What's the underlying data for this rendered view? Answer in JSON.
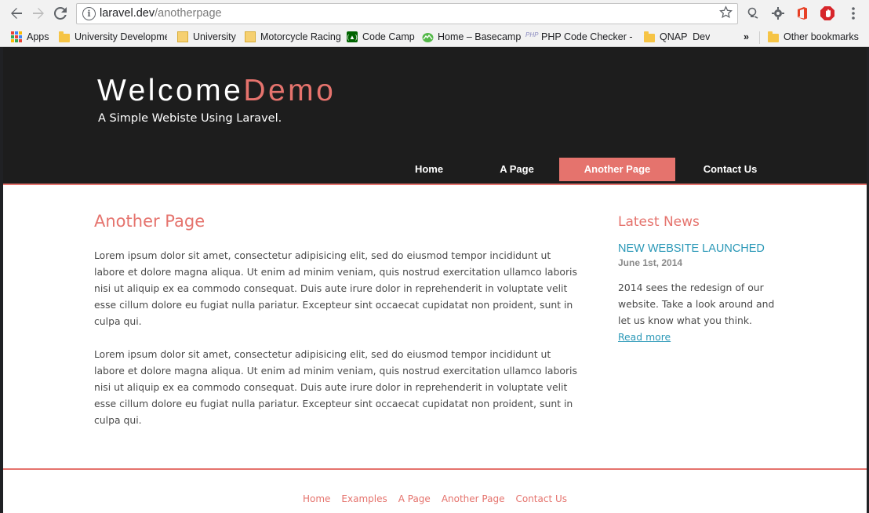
{
  "browser": {
    "url_host": "laravel.dev",
    "url_path": "/anotherpage",
    "buttons": {
      "back": "back-arrow-icon",
      "forward": "forward-arrow-icon",
      "reload": "reload-icon",
      "site_info": "info-icon",
      "bookmark": "star-icon",
      "menu": "kebab-menu-icon"
    },
    "site_info_glyph": "i",
    "bookmarks": [
      {
        "label": "Apps",
        "icon": "apps-grid-icon"
      },
      {
        "label": "University Developme",
        "icon": "folder-icon"
      },
      {
        "label": "University",
        "icon": "page-icon"
      },
      {
        "label": "Motorcycle Racing",
        "icon": "page-icon"
      },
      {
        "label": "Code Camp",
        "icon": "codecamp-icon"
      },
      {
        "label": "Home – Basecamp",
        "icon": "basecamp-icon"
      },
      {
        "label": "PHP Code Checker - S",
        "icon": "php-icon"
      },
      {
        "label": "QNAP  Dev",
        "icon": "folder-icon"
      }
    ],
    "overflow_label": "»",
    "other_bookmarks": "Other bookmarks"
  },
  "site": {
    "logo_main": "Welcome",
    "logo_accent": "Demo",
    "tagline": "A Simple Webiste Using Laravel.",
    "accent_color": "#e5736d",
    "link_color": "#2a98b7",
    "header_bg": "#1d1d1d",
    "menu": [
      {
        "label": "Home",
        "active": false
      },
      {
        "label": "A Page",
        "active": false
      },
      {
        "label": "Another Page",
        "active": true
      },
      {
        "label": "Contact Us",
        "active": false
      }
    ]
  },
  "content": {
    "title": "Another Page",
    "paragraphs": [
      "Lorem ipsum dolor sit amet, consectetur adipisicing elit, sed do eiusmod tempor incididunt ut labore et dolore magna aliqua. Ut enim ad minim veniam, quis nostrud exercitation ullamco laboris nisi ut aliquip ex ea commodo consequat. Duis aute irure dolor in reprehenderit in voluptate velit esse cillum dolore eu fugiat nulla pariatur. Excepteur sint occaecat cupidatat non proident, sunt in culpa qui.",
      "Lorem ipsum dolor sit amet, consectetur adipisicing elit, sed do eiusmod tempor incididunt ut labore et dolore magna aliqua. Ut enim ad minim veniam, quis nostrud exercitation ullamco laboris nisi ut aliquip ex ea commodo consequat. Duis aute irure dolor in reprehenderit in voluptate velit esse cillum dolore eu fugiat nulla pariatur. Excepteur sint occaecat cupidatat non proident, sunt in culpa qui."
    ]
  },
  "sidebar": {
    "title": "Latest News",
    "news_title": "NEW WEBSITE LAUNCHED",
    "news_date": "June 1st, 2014",
    "news_body": "2014 sees the redesign of our website. Take a look around and let us know what you think.",
    "read_more": "Read more"
  },
  "footer": {
    "links": [
      "Home",
      "Examples",
      "A Page",
      "Another Page",
      "Contact Us"
    ]
  }
}
